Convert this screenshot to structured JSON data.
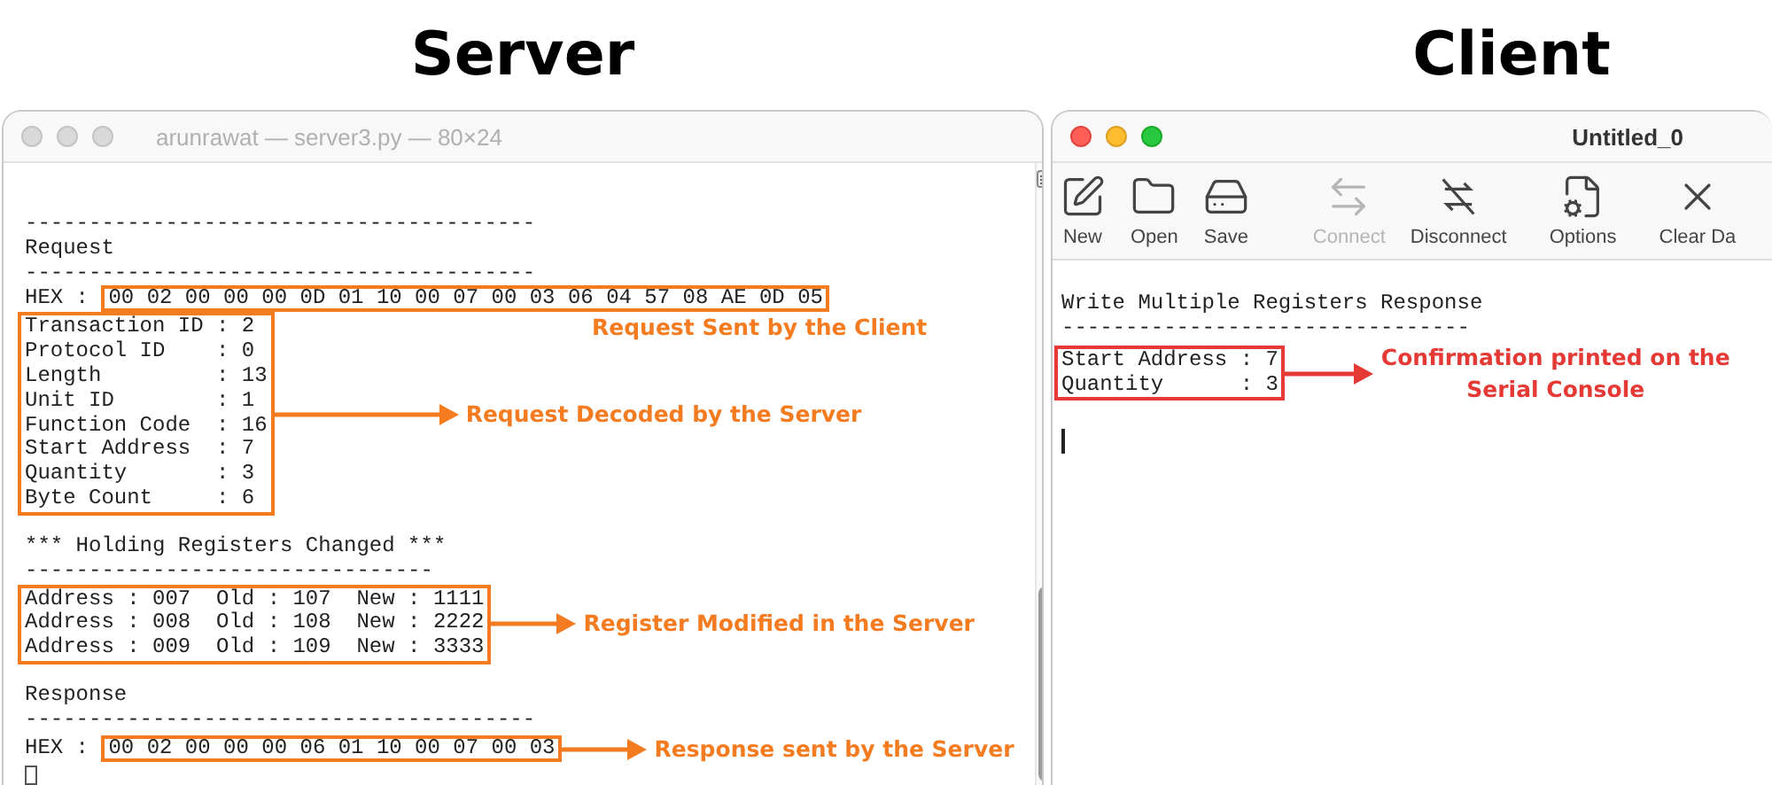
{
  "headings": [
    "Server",
    "Client"
  ],
  "server": {
    "title": "arunrawat — server3.py — 80×24",
    "blocks": [
      {
        "kind": "line",
        "text": "----------------------------------------"
      },
      {
        "kind": "line",
        "text": "Request"
      },
      {
        "kind": "line",
        "text": "----------------------------------------"
      },
      {
        "kind": "hex",
        "prefix": "HEX :",
        "value": "00 02 00 00 00 0D 01 10 00 07 00 03 06 04 57 08 AE 0D 05",
        "annotation": "Request Sent by the Client"
      },
      {
        "kind": "boxed",
        "lines": [
          "Transaction ID : 2",
          "Protocol ID    : 0",
          "Length         : 13",
          "Unit ID        : 1",
          "Function Code  : 16",
          "Start Address  : 7",
          "Quantity       : 3",
          "Byte Count     : 6"
        ],
        "annotation": "Request Decoded by the Server"
      },
      {
        "kind": "gap"
      },
      {
        "kind": "line",
        "text": "*** Holding Registers Changed ***"
      },
      {
        "kind": "line",
        "text": "--------------------------------"
      },
      {
        "kind": "boxed",
        "lines": [
          "Address : 007  Old : 107  New : 1111",
          "Address : 008  Old : 108  New : 2222",
          "Address : 009  Old : 109  New : 3333"
        ],
        "annotation": "Register Modified in the Server"
      },
      {
        "kind": "gap"
      },
      {
        "kind": "line",
        "text": "Response"
      },
      {
        "kind": "line",
        "text": "----------------------------------------"
      },
      {
        "kind": "hex",
        "prefix": "HEX :",
        "value": "00 02 00 00 00 06 01 10 00 07 00 03",
        "annotation": "Response sent by the Server"
      },
      {
        "kind": "cursor"
      }
    ]
  },
  "client": {
    "title": "Untitled_0",
    "toolbar": [
      {
        "label": "New",
        "disabled": false
      },
      {
        "label": "Open",
        "disabled": false
      },
      {
        "label": "Save",
        "disabled": false
      },
      {
        "label": "Connect",
        "disabled": true
      },
      {
        "label": "Disconnect",
        "disabled": false
      },
      {
        "label": "Options",
        "disabled": false
      },
      {
        "label": "Clear Da",
        "disabled": false
      }
    ],
    "blocks": [
      {
        "kind": "line",
        "text": "Write Multiple Registers Response"
      },
      {
        "kind": "line",
        "text": "--------------------------------"
      },
      {
        "kind": "boxed",
        "lines": [
          "Start Address : 7",
          "Quantity      : 3"
        ],
        "annotation": "Confirmation printed on the\nSerial Console"
      },
      {
        "kind": "gap"
      },
      {
        "kind": "cursor"
      }
    ]
  }
}
